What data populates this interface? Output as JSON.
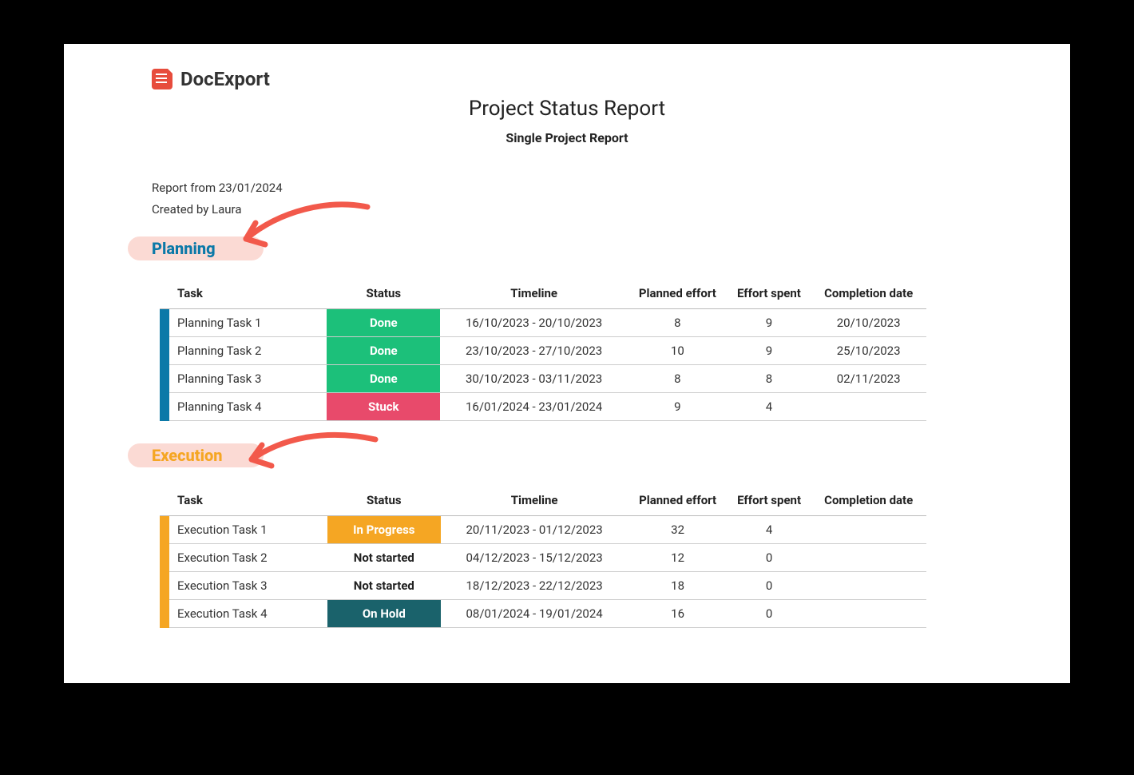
{
  "brand": {
    "name": "DocExport"
  },
  "header": {
    "title": "Project Status Report",
    "subtitle": "Single Project Report"
  },
  "meta": {
    "report_from": "Report from 23/01/2024",
    "created_by": "Created by Laura"
  },
  "columns": {
    "task": "Task",
    "status": "Status",
    "timeline": "Timeline",
    "planned_effort": "Planned effort",
    "effort_spent": "Effort spent",
    "completion_date": "Completion date"
  },
  "status_styles": {
    "Done": "Done",
    "Stuck": "Stuck",
    "In Progress": "InProgress",
    "Not started": "NotStarted",
    "On Hold": "OnHold"
  },
  "sections": [
    {
      "key": "planning",
      "title": "Planning",
      "rows": [
        {
          "task": "Planning Task 1",
          "status": "Done",
          "timeline": "16/10/2023 - 20/10/2023",
          "planned_effort": "8",
          "effort_spent": "9",
          "completion_date": "20/10/2023"
        },
        {
          "task": "Planning Task 2",
          "status": "Done",
          "timeline": "23/10/2023 - 27/10/2023",
          "planned_effort": "10",
          "effort_spent": "9",
          "completion_date": "25/10/2023"
        },
        {
          "task": "Planning Task 3",
          "status": "Done",
          "timeline": "30/10/2023 - 03/11/2023",
          "planned_effort": "8",
          "effort_spent": "8",
          "completion_date": "02/11/2023"
        },
        {
          "task": "Planning Task 4",
          "status": "Stuck",
          "timeline": "16/01/2024 - 23/01/2024",
          "planned_effort": "9",
          "effort_spent": "4",
          "completion_date": ""
        }
      ]
    },
    {
      "key": "execution",
      "title": "Execution",
      "rows": [
        {
          "task": "Execution Task 1",
          "status": "In Progress",
          "timeline": "20/11/2023 - 01/12/2023",
          "planned_effort": "32",
          "effort_spent": "4",
          "completion_date": ""
        },
        {
          "task": "Execution Task 2",
          "status": "Not started",
          "timeline": "04/12/2023 - 15/12/2023",
          "planned_effort": "12",
          "effort_spent": "0",
          "completion_date": ""
        },
        {
          "task": "Execution Task 3",
          "status": "Not started",
          "timeline": "18/12/2023 - 22/12/2023",
          "planned_effort": "18",
          "effort_spent": "0",
          "completion_date": ""
        },
        {
          "task": "Execution Task 4",
          "status": "On Hold",
          "timeline": "08/01/2024 - 19/01/2024",
          "planned_effort": "16",
          "effort_spent": "0",
          "completion_date": ""
        }
      ]
    }
  ]
}
